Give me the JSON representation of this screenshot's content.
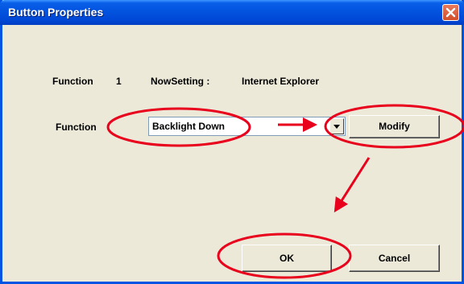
{
  "window": {
    "title": "Button Properties"
  },
  "info": {
    "function_label": "Function",
    "function_number": "1",
    "now_setting_label": "NowSetting :",
    "now_setting_value": "Internet Explorer"
  },
  "row": {
    "function_label": "Function",
    "select_value": "Backlight Down",
    "modify_label": "Modify"
  },
  "buttons": {
    "ok_label": "OK",
    "cancel_label": "Cancel"
  },
  "colors": {
    "titlebar": "#0054e3",
    "dialog_bg": "#ece9d8",
    "annotation": "#e8001c"
  },
  "icons": {
    "close": "close-icon",
    "dropdown": "chevron-down-icon"
  }
}
